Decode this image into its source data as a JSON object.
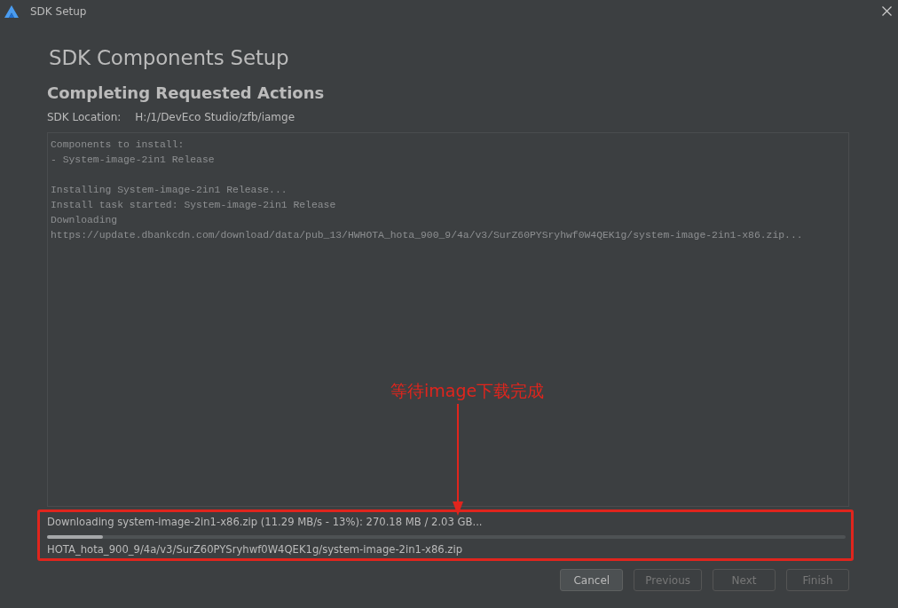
{
  "window": {
    "title": "SDK Setup"
  },
  "heading": "SDK Components Setup",
  "subheading": "Completing Requested Actions",
  "sdk_location": {
    "label": "SDK Location:",
    "value": "H:/1/DevEco Studio/zfb/iamge"
  },
  "log": [
    [
      "Components to install:",
      "- System-image-2in1 Release"
    ],
    [
      "Installing System-image-2in1 Release...",
      "Install task started: System-image-2in1 Release",
      "Downloading",
      "https://update.dbankcdn.com/download/data/pub_13/HWHOTA_hota_900_9/4a/v3/SurZ60PYSryhwf0W4QEK1g/system-image-2in1-x86.zip..."
    ]
  ],
  "progress": {
    "status": "Downloading system-image-2in1-x86.zip (11.29 MB/s - 13%): 270.18 MB / 2.03 GB...",
    "level": 0.07,
    "detail": "HOTA_hota_900_9/4a/v3/SurZ60PYSryhwf0W4QEK1g/system-image-2in1-x86.zip"
  },
  "annotation": {
    "text": "等待image下载完成"
  },
  "buttons": [
    {
      "label": "Cancel",
      "disabled": false
    },
    {
      "label": "Previous",
      "disabled": true
    },
    {
      "label": "Next",
      "disabled": true
    },
    {
      "label": "Finish",
      "disabled": true
    }
  ]
}
